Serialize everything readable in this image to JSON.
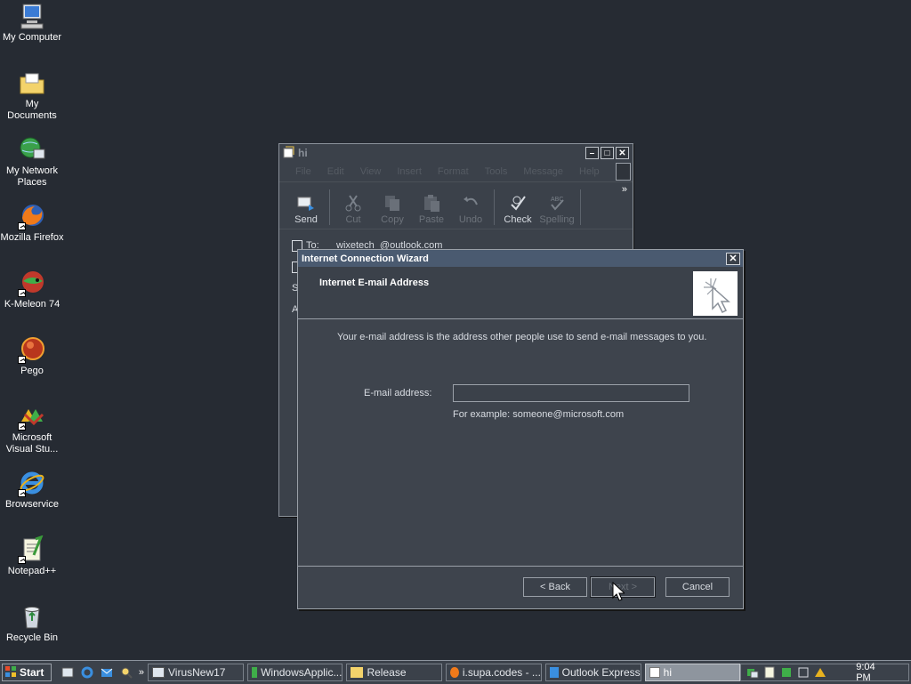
{
  "desktop": {
    "icons": [
      {
        "label": "My Computer",
        "icon": "computer-icon"
      },
      {
        "label": "My Documents",
        "icon": "folder-icon"
      },
      {
        "label": "My Network Places",
        "icon": "network-icon"
      },
      {
        "label": "Mozilla Firefox",
        "icon": "firefox-icon"
      },
      {
        "label": "K-Meleon 74",
        "icon": "kmeleon-icon"
      },
      {
        "label": "Pego",
        "icon": "pego-icon"
      },
      {
        "label": "Microsoft Visual Stu...",
        "icon": "visual-studio-icon"
      },
      {
        "label": "Browservice",
        "icon": "ie-icon"
      },
      {
        "label": "Notepad++",
        "icon": "notepad-icon"
      },
      {
        "label": "Recycle Bin",
        "icon": "recycle-bin-icon"
      }
    ]
  },
  "message_window": {
    "title": "hi",
    "menu": [
      "File",
      "Edit",
      "View",
      "Insert",
      "Format",
      "Tools",
      "Message",
      "Help"
    ],
    "toolbar": [
      {
        "label": "Send",
        "icon": "send-icon",
        "enabled": true
      },
      {
        "label": "Cut",
        "icon": "cut-icon",
        "enabled": false
      },
      {
        "label": "Copy",
        "icon": "copy-icon",
        "enabled": false
      },
      {
        "label": "Paste",
        "icon": "paste-icon",
        "enabled": false
      },
      {
        "label": "Undo",
        "icon": "undo-icon",
        "enabled": false
      },
      {
        "label": "Check",
        "icon": "check-icon",
        "enabled": true
      },
      {
        "label": "Spelling",
        "icon": "spelling-icon",
        "enabled": false
      }
    ],
    "to_label": "To:",
    "to_value": "wixetech_@outlook.com",
    "field_initials": [
      "S",
      "A"
    ]
  },
  "wizard": {
    "title": "Internet Connection Wizard",
    "heading": "Internet E-mail Address",
    "description": "Your e-mail address is the address other people use to send e-mail messages to you.",
    "email_label": "E-mail address:",
    "email_value": "",
    "example": "For example: someone@microsoft.com",
    "back_label": "< Back",
    "next_label": "Next >",
    "cancel_label": "Cancel"
  },
  "taskbar": {
    "start_label": "Start",
    "tasks": [
      {
        "label": "VirusNew17",
        "icon": "computer-icon",
        "active": false
      },
      {
        "label": "WindowsApplic...",
        "icon": "visual-studio-icon",
        "active": false
      },
      {
        "label": "Release",
        "icon": "folder-icon",
        "active": false
      },
      {
        "label": "i.supa.codes - ...",
        "icon": "firefox-icon",
        "active": false
      },
      {
        "label": "Outlook Express",
        "icon": "outlook-icon",
        "active": false
      },
      {
        "label": "hi",
        "icon": "message-icon",
        "active": true
      }
    ],
    "clock": "9:04 PM"
  },
  "colors": {
    "desktop": "#262b33",
    "window": "#3b414a",
    "title_active": "#4a5a70"
  }
}
